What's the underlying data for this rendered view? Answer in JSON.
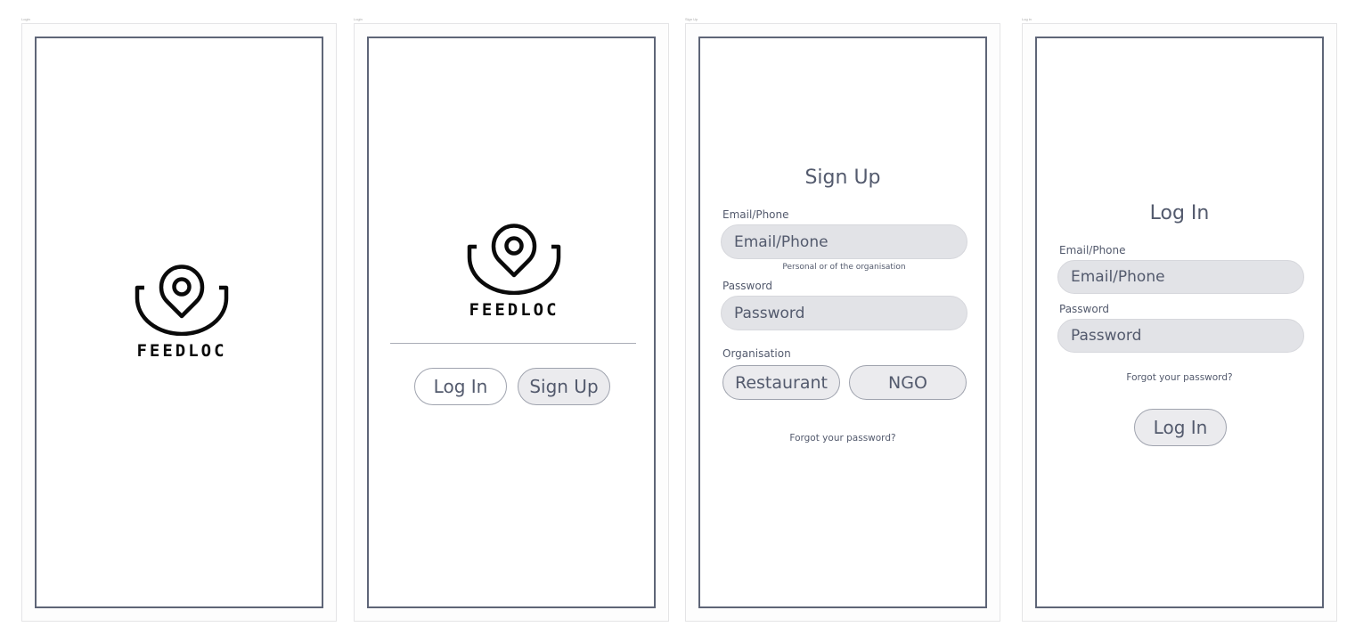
{
  "artboards": [
    {
      "label": "Login"
    },
    {
      "label": "Login"
    },
    {
      "label": "Sign Up"
    },
    {
      "label": "Log in"
    }
  ],
  "brand": {
    "name": "FEEDLOC",
    "logo_icon": "map-pin-bowl-icon"
  },
  "splash": {},
  "welcome": {
    "login_button": "Log In",
    "signup_button": "Sign Up"
  },
  "signup": {
    "title": "Sign Up",
    "email_label": "Email/Phone",
    "email_placeholder": "Email/Phone",
    "email_hint": "Personal or of the organisation",
    "password_label": "Password",
    "password_placeholder": "Password",
    "organisation_label": "Organisation",
    "organisation_options": [
      "Restaurant",
      "NGO"
    ],
    "forgot_link": "Forgot your password?"
  },
  "login": {
    "title": "Log In",
    "email_label": "Email/Phone",
    "email_placeholder": "Email/Phone",
    "password_label": "Password",
    "password_placeholder": "Password",
    "forgot_link": "Forgot your password?",
    "submit_button": "Log In"
  }
}
